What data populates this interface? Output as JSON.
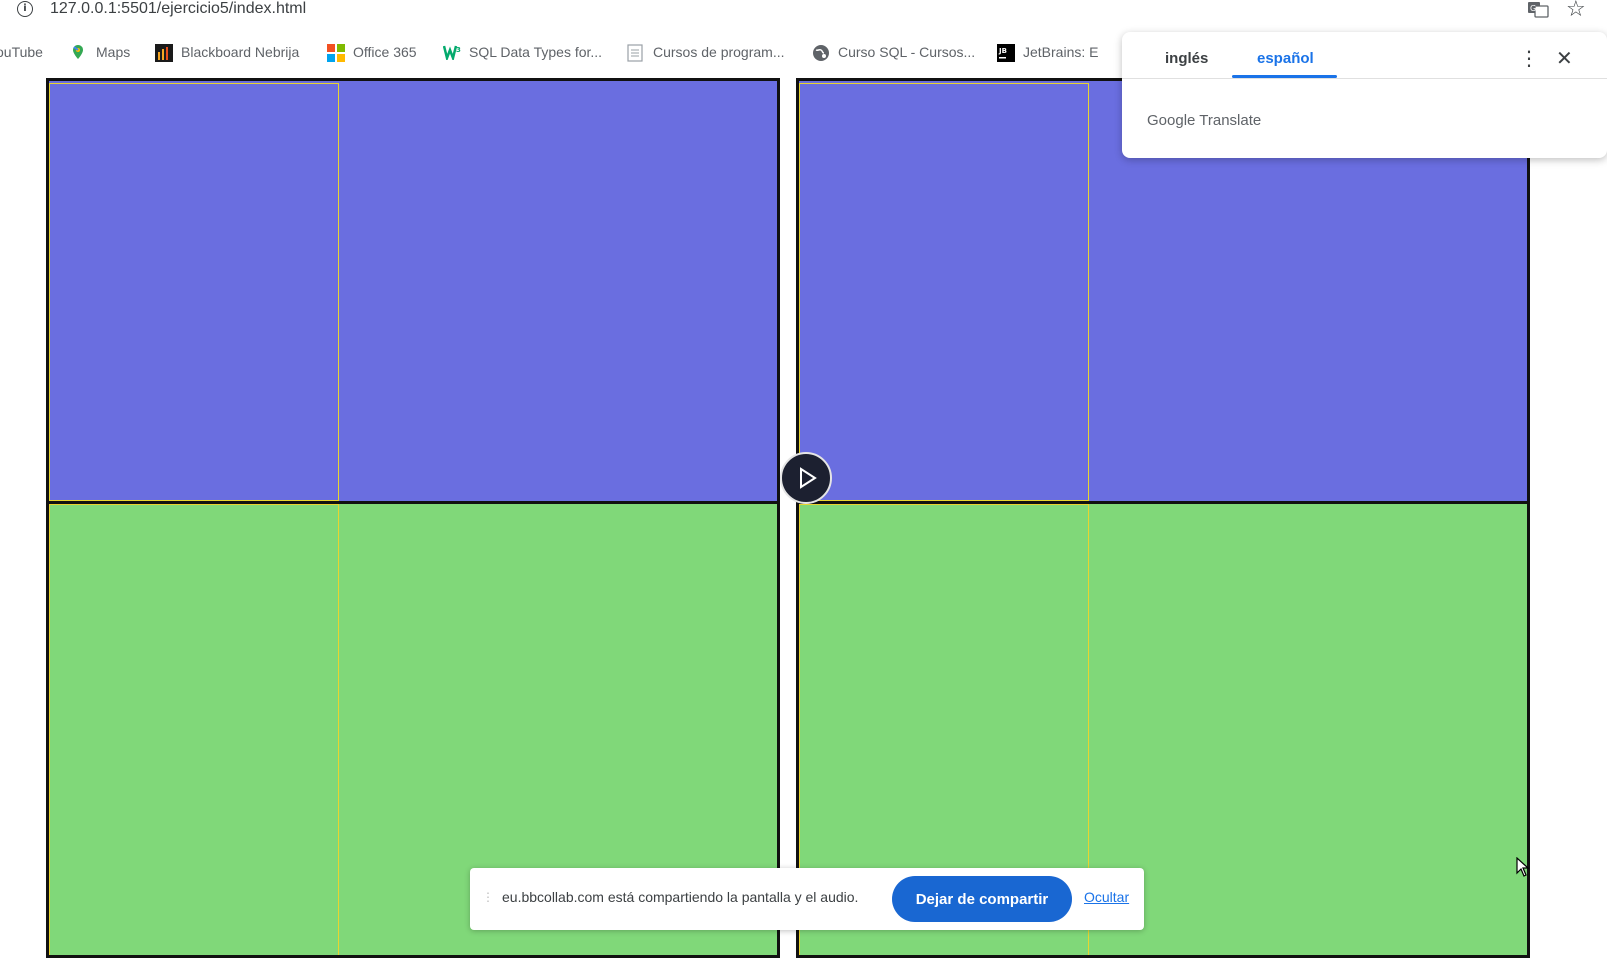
{
  "browser": {
    "url": "127.0.0.1:5501/ejercicio5/index.html",
    "icons": {
      "info": "info-icon",
      "translate": "translate-icon",
      "bookmark": "star-icon"
    }
  },
  "bookmarks": [
    {
      "label": "ouTube",
      "icon": "youtube-icon"
    },
    {
      "label": "Maps",
      "icon": "maps-icon"
    },
    {
      "label": "Blackboard Nebrija",
      "icon": "blackboard-icon"
    },
    {
      "label": "Office 365",
      "icon": "office-icon"
    },
    {
      "label": "SQL Data Types for...",
      "icon": "w3-icon"
    },
    {
      "label": "Cursos de program...",
      "icon": "page-icon"
    },
    {
      "label": "Curso SQL - Cursos...",
      "icon": "globe-icon"
    },
    {
      "label": "JetBrains: E",
      "icon": "jetbrains-icon"
    }
  ],
  "page": {
    "colors": {
      "top": "#6a6ee0",
      "bottom": "#80d879",
      "cell_border": "#e8d530",
      "box_border": "#111111"
    }
  },
  "translate_popup": {
    "tab_source": "inglés",
    "tab_target": "español",
    "brand": "Google Translate",
    "icons": {
      "menu": "more-vert-icon",
      "close": "close-icon"
    }
  },
  "share_bar": {
    "message": "eu.bbcollab.com está compartiendo la pantalla y el audio.",
    "stop_label": "Dejar de compartir",
    "hide_label": "Ocultar"
  },
  "overlay": {
    "play_icon": "play-icon"
  }
}
